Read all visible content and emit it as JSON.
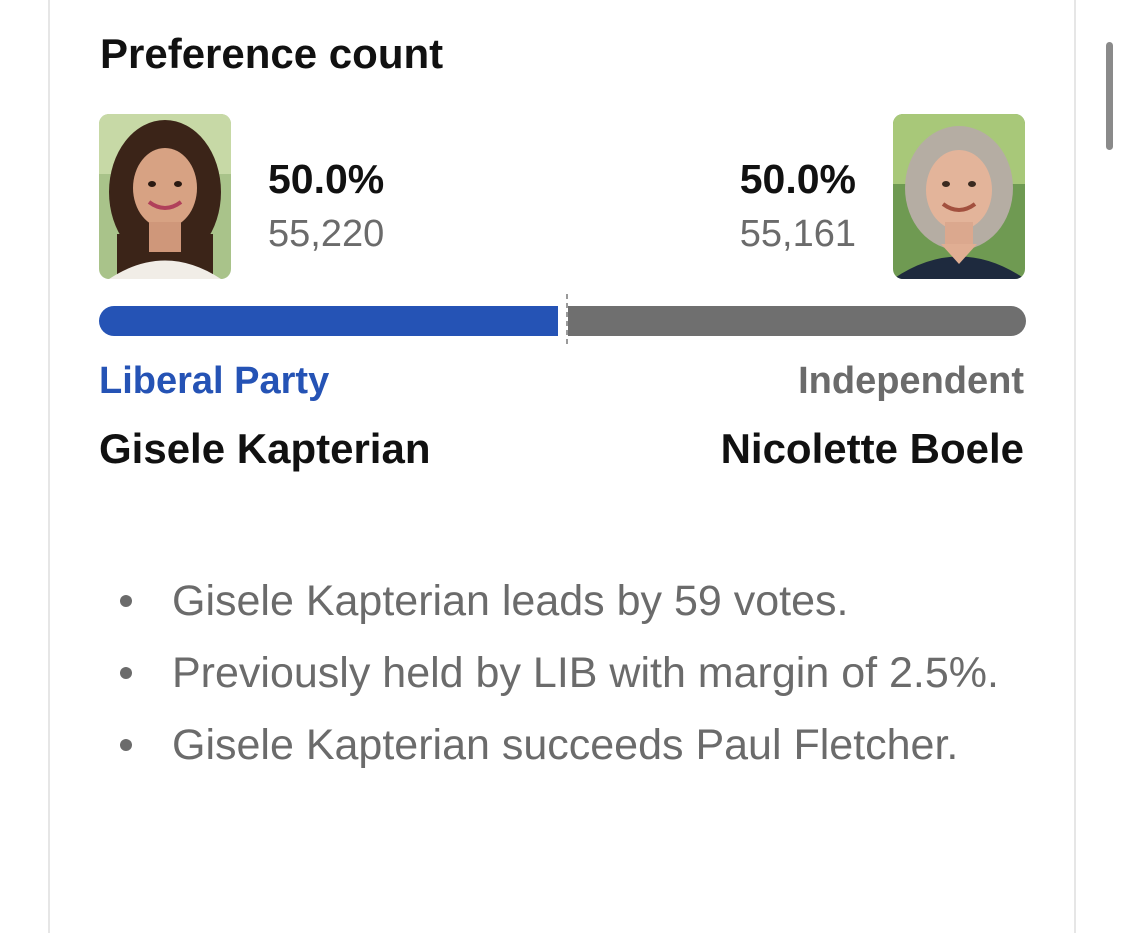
{
  "card": {
    "title": "Preference count"
  },
  "candidates": {
    "left": {
      "percent": "50.0%",
      "votes": "55,220",
      "party": "Liberal Party",
      "name": "Gisele Kapterian",
      "color": "#2553b5"
    },
    "right": {
      "percent": "50.0%",
      "votes": "55,161",
      "party": "Independent",
      "name": "Nicolette Boele",
      "color": "#6f6f6f"
    }
  },
  "bar": {
    "left_share": 0.5003,
    "right_share": 0.4997
  },
  "notes": [
    "Gisele Kapterian leads by 59 votes.",
    "Previously held by LIB with margin of 2.5%.",
    "Gisele Kapterian succeeds Paul Fletcher."
  ]
}
